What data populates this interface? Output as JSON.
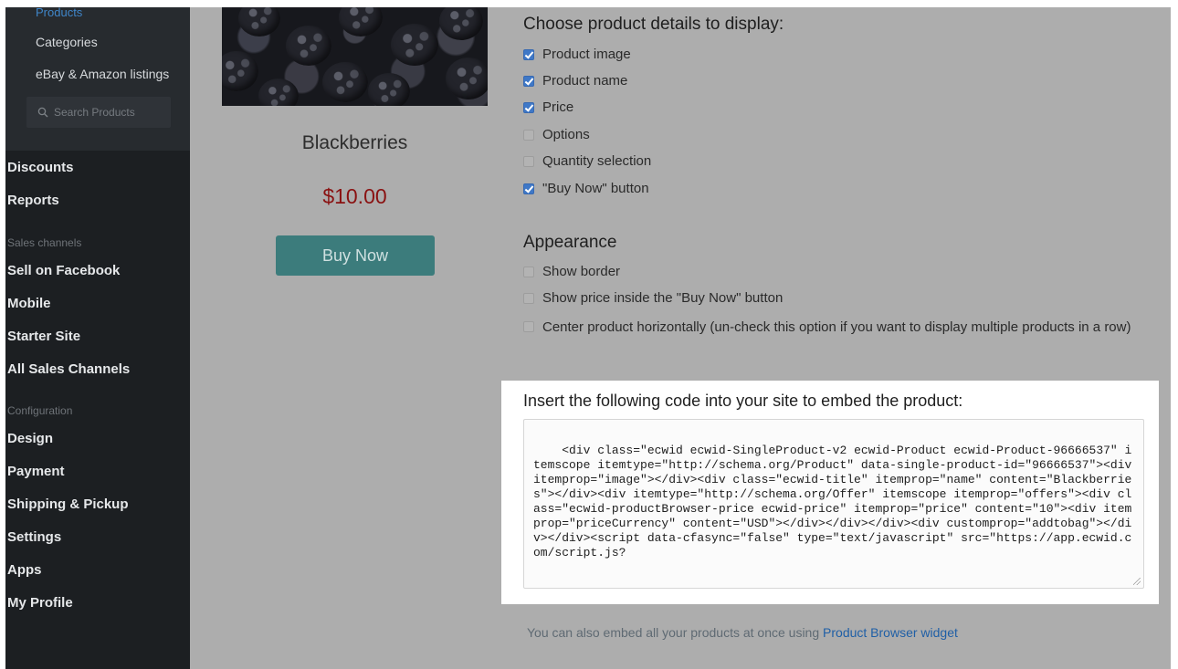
{
  "sidebar": {
    "sub_items": [
      {
        "label": "Products",
        "active": true
      },
      {
        "label": "Categories",
        "active": false
      },
      {
        "label": "eBay & Amazon listings",
        "active": false
      }
    ],
    "search_placeholder": "Search Products",
    "nav": [
      {
        "type": "item",
        "label": "Discounts"
      },
      {
        "type": "item",
        "label": "Reports"
      },
      {
        "type": "section",
        "label": "Sales channels"
      },
      {
        "type": "item",
        "label": "Sell on Facebook"
      },
      {
        "type": "item",
        "label": "Mobile"
      },
      {
        "type": "item",
        "label": "Starter Site"
      },
      {
        "type": "item",
        "label": "All Sales Channels"
      },
      {
        "type": "section",
        "label": "Configuration"
      },
      {
        "type": "item",
        "label": "Design"
      },
      {
        "type": "item",
        "label": "Payment"
      },
      {
        "type": "item",
        "label": "Shipping & Pickup"
      },
      {
        "type": "item",
        "label": "Settings"
      },
      {
        "type": "item",
        "label": "Apps"
      },
      {
        "type": "item",
        "label": "My Profile"
      }
    ]
  },
  "product": {
    "name": "Blackberries",
    "price": "$10.00",
    "buy_label": "Buy Now"
  },
  "details": {
    "heading": "Choose product details to display:",
    "options": [
      {
        "label": "Product image",
        "checked": true
      },
      {
        "label": "Product name",
        "checked": true
      },
      {
        "label": "Price",
        "checked": true
      },
      {
        "label": "Options",
        "checked": false
      },
      {
        "label": "Quantity selection",
        "checked": false
      },
      {
        "label": "\"Buy Now\" button",
        "checked": true
      }
    ]
  },
  "appearance": {
    "heading": "Appearance",
    "options": [
      {
        "label": "Show border",
        "checked": false
      },
      {
        "label": "Show price inside the \"Buy Now\" button",
        "checked": false
      }
    ],
    "center_option": {
      "label": "Center product horizontally (un-check this option if you want to display multiple products in a row)",
      "checked": false
    }
  },
  "embed": {
    "heading": "Insert the following code into your site to embed the product:",
    "code": "<div class=\"ecwid ecwid-SingleProduct-v2 ecwid-Product ecwid-Product-96666537\" itemscope itemtype=\"http://schema.org/Product\" data-single-product-id=\"96666537\"><div itemprop=\"image\"></div><div class=\"ecwid-title\" itemprop=\"name\" content=\"Blackberries\"></div><div itemtype=\"http://schema.org/Offer\" itemscope itemprop=\"offers\"><div class=\"ecwid-productBrowser-price ecwid-price\" itemprop=\"price\" content=\"10\"><div itemprop=\"priceCurrency\" content=\"USD\"></div></div></div><div customprop=\"addtobag\"></div></div><script data-cfasync=\"false\" type=\"text/javascript\" src=\"https://app.ecwid.com/script.js?"
  },
  "footer": {
    "text": "You can also embed all your products at once using ",
    "link": "Product Browser widget"
  },
  "colors": {
    "accent": "#3f78c7",
    "price": "#8a1111",
    "button": "#3c7c7c",
    "sidebar": "#1c1f22"
  }
}
